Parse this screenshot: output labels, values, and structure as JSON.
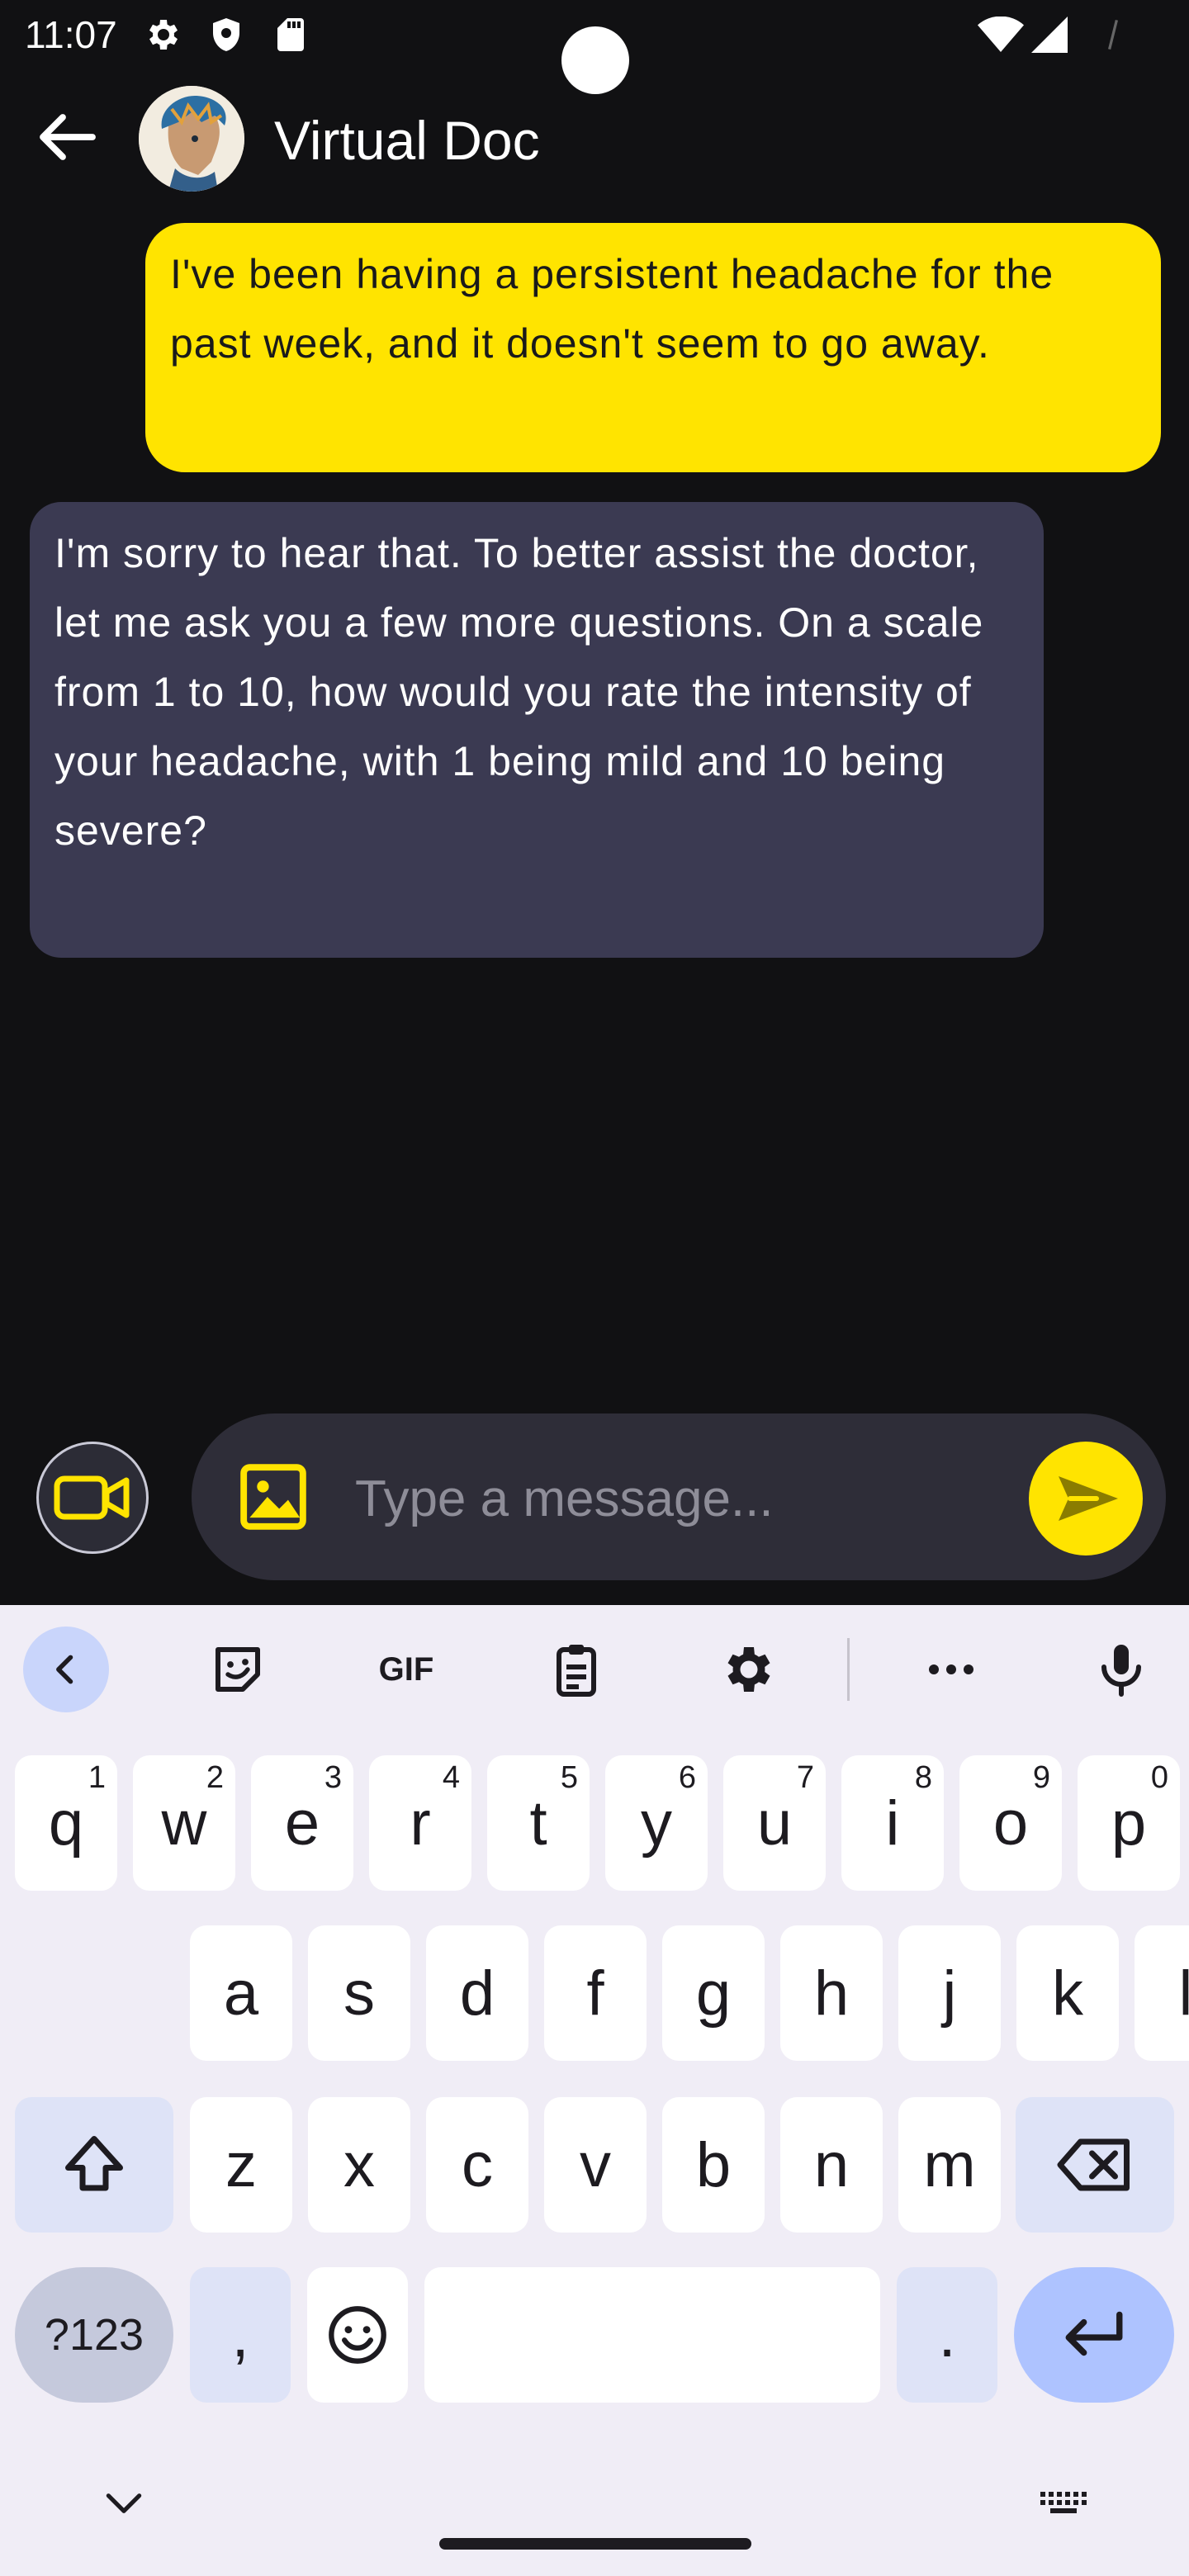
{
  "status_bar": {
    "time": "11:07"
  },
  "header": {
    "title": "Virtual Doc",
    "back_icon": "arrow-back-icon",
    "avatar": "doctor-avatar"
  },
  "messages": [
    {
      "sender": "user",
      "text": "I've been having a persistent headache for the past week, and it doesn't seem to go away."
    },
    {
      "sender": "bot",
      "text": "I'm sorry to hear that. To better assist the doctor, let me ask you a few more questions. On a scale from 1 to 10, how would you rate the intensity of your headache, with 1 being mild and 10 being severe?"
    }
  ],
  "composer": {
    "placeholder": "Type a message..."
  },
  "colors": {
    "user_bubble": "#ffe400",
    "bot_bubble": "#3b3a52",
    "background": "#111113",
    "accent": "#ffe400"
  },
  "keyboard": {
    "toolbar": {
      "gif_label": "GIF"
    },
    "row1": [
      {
        "key": "q",
        "sup": "1"
      },
      {
        "key": "w",
        "sup": "2"
      },
      {
        "key": "e",
        "sup": "3"
      },
      {
        "key": "r",
        "sup": "4"
      },
      {
        "key": "t",
        "sup": "5"
      },
      {
        "key": "y",
        "sup": "6"
      },
      {
        "key": "u",
        "sup": "7"
      },
      {
        "key": "i",
        "sup": "8"
      },
      {
        "key": "o",
        "sup": "9"
      },
      {
        "key": "p",
        "sup": "0"
      }
    ],
    "row2": [
      "a",
      "s",
      "d",
      "f",
      "g",
      "h",
      "j",
      "k",
      "l"
    ],
    "row3": [
      "z",
      "x",
      "c",
      "v",
      "b",
      "n",
      "m"
    ],
    "symbols_label": "?123",
    "comma": ",",
    "period": "."
  }
}
